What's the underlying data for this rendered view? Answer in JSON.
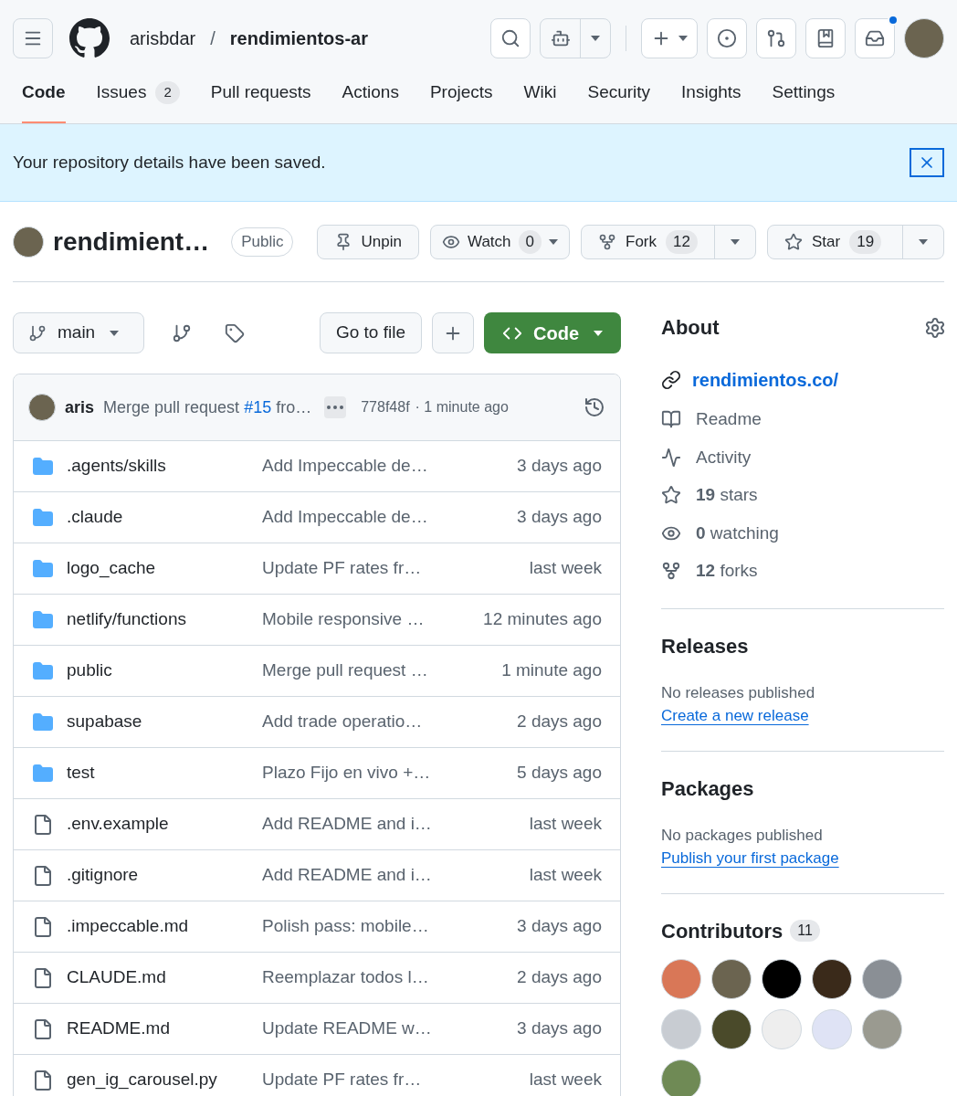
{
  "header": {
    "owner": "arisbdar",
    "separator": "/",
    "repo": "rendimientos-ar",
    "notification_dot": true
  },
  "tabs": [
    {
      "label": "Code",
      "selected": true
    },
    {
      "label": "Issues",
      "count": "2",
      "selected": false
    },
    {
      "label": "Pull requests",
      "selected": false
    },
    {
      "label": "Actions",
      "selected": false
    },
    {
      "label": "Projects",
      "selected": false
    },
    {
      "label": "Wiki",
      "selected": false
    },
    {
      "label": "Security",
      "selected": false
    },
    {
      "label": "Insights",
      "selected": false
    },
    {
      "label": "Settings",
      "selected": false
    }
  ],
  "flash": {
    "message": "Your repository details have been saved."
  },
  "repo_header": {
    "name": "rendimient…",
    "visibility": "Public",
    "unpin": "Unpin",
    "watch": {
      "label": "Watch",
      "count": "0"
    },
    "fork": {
      "label": "Fork",
      "count": "12"
    },
    "star": {
      "label": "Star",
      "count": "19"
    }
  },
  "toolbar": {
    "branch": "main",
    "go_to_file": "Go to file",
    "code": "Code"
  },
  "commit": {
    "author": "aris",
    "message": "Merge pull request ",
    "link": "#15",
    "message_end": " fro…",
    "sha": "778f48f",
    "time": "· 1 minute ago"
  },
  "files": [
    {
      "kind": "folder",
      "name": ".agents/skills",
      "message": "Add Impeccable de…",
      "time": "3 days ago"
    },
    {
      "kind": "folder",
      "name": ".claude",
      "message": "Add Impeccable de…",
      "time": "3 days ago"
    },
    {
      "kind": "folder",
      "name": "logo_cache",
      "message": "Update PF rates fr…",
      "time": "last week"
    },
    {
      "kind": "folder",
      "name": "netlify/functions",
      "message": "Mobile responsive …",
      "time": "12 minutes ago"
    },
    {
      "kind": "folder",
      "name": "public",
      "message": "Merge pull request …",
      "time": "1 minute ago"
    },
    {
      "kind": "folder",
      "name": "supabase",
      "message": "Add trade operatio…",
      "time": "2 days ago"
    },
    {
      "kind": "folder",
      "name": "test",
      "message": "Plazo Fijo en vivo +…",
      "time": "5 days ago"
    },
    {
      "kind": "file",
      "name": ".env.example",
      "message": "Add README and i…",
      "time": "last week"
    },
    {
      "kind": "file",
      "name": ".gitignore",
      "message": "Add README and i…",
      "time": "last week"
    },
    {
      "kind": "file",
      "name": ".impeccable.md",
      "message": "Polish pass: mobile…",
      "time": "3 days ago"
    },
    {
      "kind": "file",
      "name": "CLAUDE.md",
      "message": "Reemplazar todos l…",
      "time": "2 days ago"
    },
    {
      "kind": "file",
      "name": "README.md",
      "message": "Update README w…",
      "time": "3 days ago"
    },
    {
      "kind": "file",
      "name": "gen_ig_carousel.py",
      "message": "Update PF rates fr…",
      "time": "last week"
    }
  ],
  "about": {
    "title": "About",
    "website": "rendimientos.co/",
    "items": [
      {
        "kind": "readme",
        "label": "Readme"
      },
      {
        "kind": "activity",
        "label": "Activity"
      },
      {
        "kind": "stars",
        "count": "19",
        "label": " stars"
      },
      {
        "kind": "watching",
        "count": "0",
        "label": " watching"
      },
      {
        "kind": "forks",
        "count": "12",
        "label": " forks"
      }
    ]
  },
  "releases": {
    "title": "Releases",
    "empty": "No releases published",
    "link": "Create a new release"
  },
  "packages": {
    "title": "Packages",
    "empty": "No packages published",
    "link": "Publish your first package"
  },
  "contributors": {
    "title": "Contributors",
    "count": "11",
    "avatars": [
      {
        "color": "#d97757"
      },
      {
        "color": "#6b6450"
      },
      {
        "color": "#000000"
      },
      {
        "color": "#3a2a1a"
      },
      {
        "color": "#8a8f95"
      },
      {
        "color": "#c8ccd2"
      },
      {
        "color": "#4a4a2a"
      },
      {
        "color": "#eeeeee"
      },
      {
        "color": "#dfe3f5"
      },
      {
        "color": "#9a9a90"
      },
      {
        "color": "#6f8a55"
      }
    ]
  }
}
